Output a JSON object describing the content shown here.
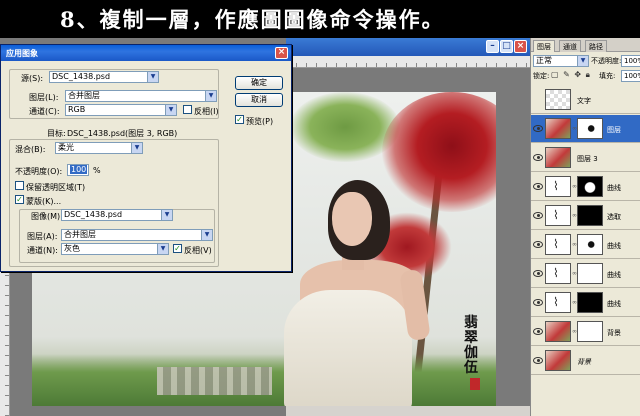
{
  "caption": "8、複制一層，作應圖圖像命令操作。",
  "document": {
    "minimize_icon": "minimize-icon",
    "maximize_icon": "maximize-icon",
    "close_icon": "close-icon"
  },
  "dialog": {
    "title": "应用图象",
    "source_label": "源(S):",
    "source_value": "DSC_1438.psd",
    "layer_label": "图层(L):",
    "layer_value": "合并图层",
    "channel_label": "通道(C):",
    "channel_value": "RGB",
    "invert1_label": "反相(I)",
    "invert1_checked": false,
    "target_label": "目标:",
    "target_value": "DSC_1438.psd(图层 3, RGB)",
    "blending_label": "混合(B):",
    "blending_value": "柔光",
    "opacity_label": "不透明度(O):",
    "opacity_value": "100",
    "opacity_unit": "%",
    "preserve_label": "保留透明区域(T)",
    "preserve_checked": false,
    "mask_label": "蒙版(K)...",
    "mask_checked": true,
    "image_label": "图像(M):",
    "image_value": "DSC_1438.psd",
    "mask_layer_label": "图层(A):",
    "mask_layer_value": "合并图层",
    "mask_channel_label": "通道(N):",
    "mask_channel_value": "灰色",
    "invert2_label": "反相(V)",
    "invert2_checked": true,
    "ok_label": "确定",
    "cancel_label": "取消",
    "preview_label": "预览(P)",
    "preview_checked": true
  },
  "signature": "翡翠伽伍",
  "panel": {
    "tabs": [
      "图层",
      "通道",
      "路径"
    ],
    "active_tab": 0,
    "blend_mode": "正常",
    "opacity_label": "不透明度:",
    "opacity_value": "100%",
    "lock_label": "锁定:",
    "fill_label": "填充:",
    "fill_value": "100%",
    "layers": [
      {
        "name": "文字",
        "thumb": "checker",
        "mask": null,
        "visible": false
      },
      {
        "name": "图层",
        "thumb": "photo",
        "mask": "mixed",
        "visible": true,
        "selected": true
      },
      {
        "name": "图层 3",
        "thumb": "photo",
        "mask": null,
        "visible": true
      },
      {
        "name": "曲线",
        "thumb": "adj",
        "mask": "mixed2",
        "visible": true
      },
      {
        "name": "选取",
        "thumb": "adj",
        "mask": "black",
        "visible": true
      },
      {
        "name": "曲线",
        "thumb": "adj",
        "mask": "mixed",
        "visible": true
      },
      {
        "name": "曲线",
        "thumb": "adj",
        "mask": "white",
        "visible": true
      },
      {
        "name": "曲线",
        "thumb": "adj",
        "mask": "black",
        "visible": true
      },
      {
        "name": "背景",
        "thumb": "photo",
        "mask": "white",
        "visible": true
      },
      {
        "name": "背景",
        "thumb": "photo",
        "mask": null,
        "visible": true,
        "background": true
      }
    ]
  }
}
